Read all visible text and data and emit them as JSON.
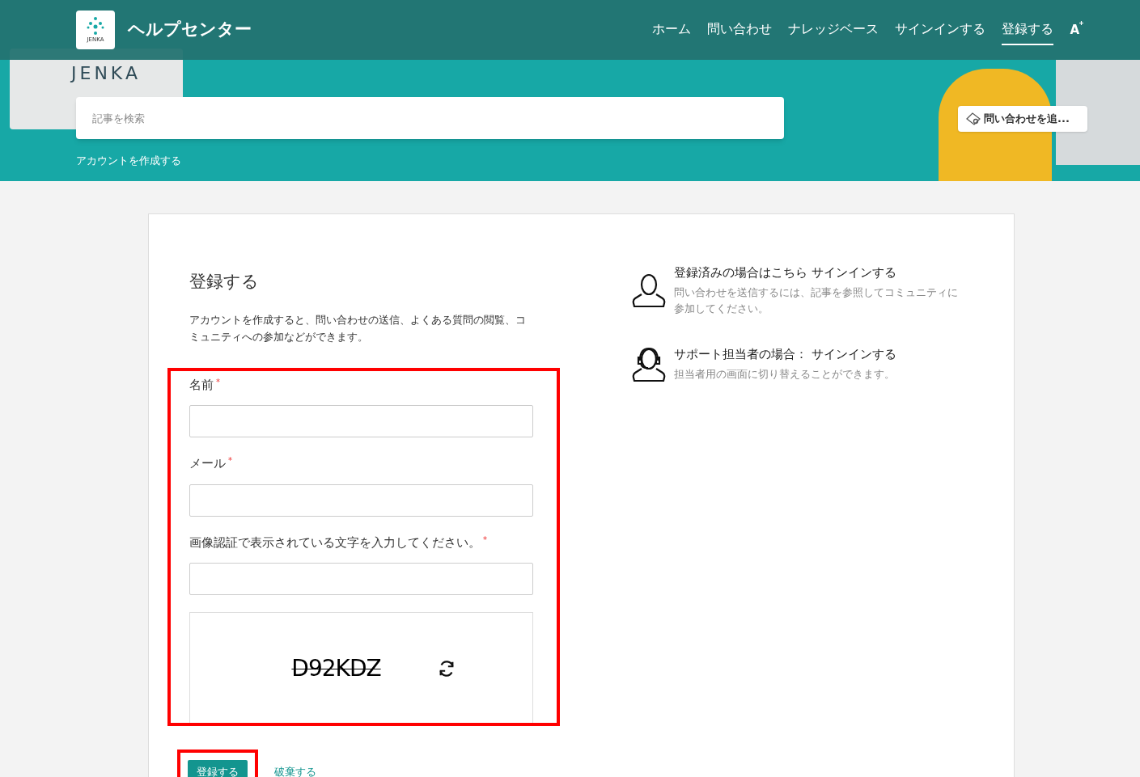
{
  "header": {
    "logo_text": "JENKA",
    "title": "ヘルプセンター",
    "nav": [
      {
        "label": "ホーム",
        "selected": false
      },
      {
        "label": "問い合わせ",
        "selected": false
      },
      {
        "label": "ナレッジベース",
        "selected": false
      },
      {
        "label": "サインインする",
        "selected": false
      },
      {
        "label": "登録する",
        "selected": true
      }
    ],
    "text_size_label": "A"
  },
  "banner": {
    "illustration_text": "JENKA",
    "search": {
      "placeholder": "記事を検索"
    },
    "breadcrumb": "アカウントを作成する",
    "ticket_button": "問い合わせを追..."
  },
  "form": {
    "title": "登録する",
    "description": "アカウントを作成すると、問い合わせの送信、よくある質問の閲覧、コミュニティへの参加などができます。",
    "fields": [
      {
        "label": "名前",
        "required": true
      },
      {
        "label": "メール",
        "required": true
      },
      {
        "label": "画像認証で表示されている文字を入力してください。",
        "required": true
      }
    ],
    "required_mark": "*",
    "captcha": "D92KDZ",
    "submit": "登録する",
    "discard": "破棄する"
  },
  "side": [
    {
      "kind": "user",
      "title": "登録済みの場合はこちら",
      "link": "サインインする",
      "text": "問い合わせを送信するには、記事を参照してコミュニティに参加してください。"
    },
    {
      "kind": "agent",
      "title": "サポート担当者の場合：",
      "link": "サインインする",
      "text": "担当者用の画面に切り替えることができます。"
    }
  ]
}
